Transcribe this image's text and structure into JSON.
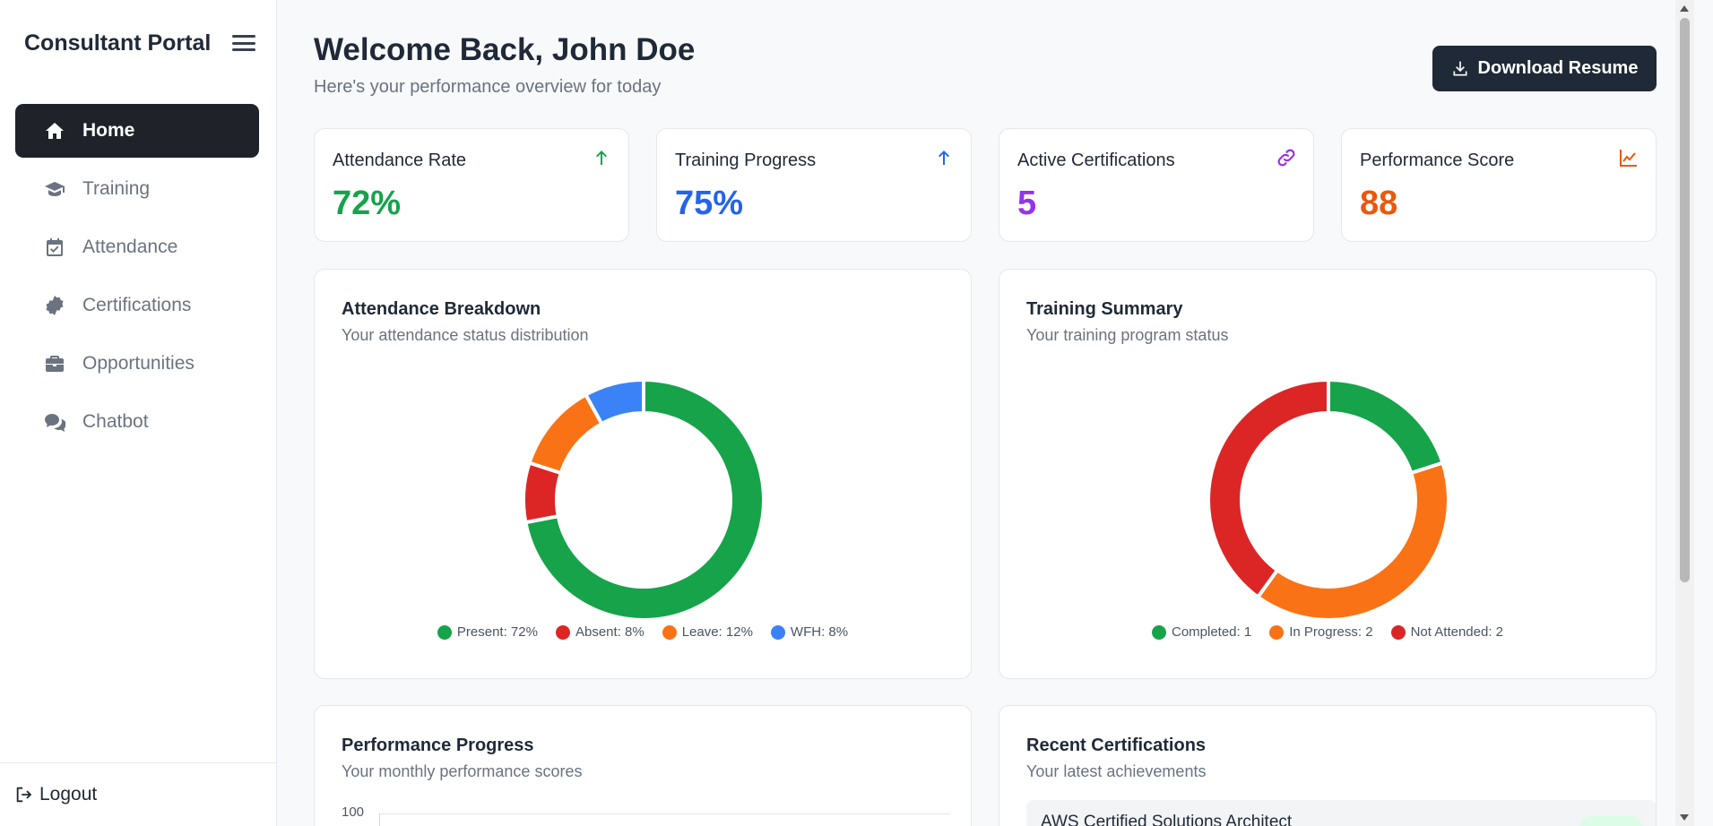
{
  "sidebar": {
    "title": "Consultant Portal",
    "items": [
      {
        "label": "Home",
        "icon": "home-icon",
        "active": true
      },
      {
        "label": "Training",
        "icon": "graduation-cap-icon",
        "active": false
      },
      {
        "label": "Attendance",
        "icon": "calendar-check-icon",
        "active": false
      },
      {
        "label": "Certifications",
        "icon": "certificate-icon",
        "active": false
      },
      {
        "label": "Opportunities",
        "icon": "briefcase-icon",
        "active": false
      },
      {
        "label": "Chatbot",
        "icon": "chat-icon",
        "active": false
      }
    ],
    "logout_label": "Logout"
  },
  "header": {
    "welcome": "Welcome Back, John Doe",
    "subtitle": "Here's your performance overview for today",
    "download_label": "Download Resume"
  },
  "stats": [
    {
      "label": "Attendance Rate",
      "value": "72%",
      "color": "#16a34a",
      "icon": "arrow-up-icon"
    },
    {
      "label": "Training Progress",
      "value": "75%",
      "color": "#2563eb",
      "icon": "arrow-up-icon"
    },
    {
      "label": "Active Certifications",
      "value": "5",
      "color": "#9333ea",
      "icon": "link-icon"
    },
    {
      "label": "Performance Score",
      "value": "88",
      "color": "#ea580c",
      "icon": "chart-line-icon"
    }
  ],
  "attendance_card": {
    "title": "Attendance Breakdown",
    "subtitle": "Your attendance status distribution",
    "legend": [
      "Present: 72%",
      "Absent: 8%",
      "Leave: 12%",
      "WFH: 8%"
    ]
  },
  "training_card": {
    "title": "Training Summary",
    "subtitle": "Your training program status",
    "legend": [
      "Completed: 1",
      "In Progress: 2",
      "Not Attended: 2"
    ]
  },
  "performance_card": {
    "title": "Performance Progress",
    "subtitle": "Your monthly performance scores",
    "y_top_label": "100"
  },
  "certs_card": {
    "title": "Recent Certifications",
    "subtitle": "Your latest achievements",
    "first_item": "AWS Certified Solutions Architect"
  },
  "chart_data": [
    {
      "type": "pie",
      "categories": [
        "Present",
        "Absent",
        "Leave",
        "WFH"
      ],
      "values": [
        72,
        8,
        12,
        8
      ],
      "colors": [
        "#16a34a",
        "#dc2626",
        "#f97316",
        "#3b82f6"
      ]
    },
    {
      "type": "pie",
      "categories": [
        "Completed",
        "In Progress",
        "Not Attended"
      ],
      "values": [
        1,
        2,
        2
      ],
      "colors": [
        "#16a34a",
        "#f97316",
        "#dc2626"
      ]
    }
  ]
}
